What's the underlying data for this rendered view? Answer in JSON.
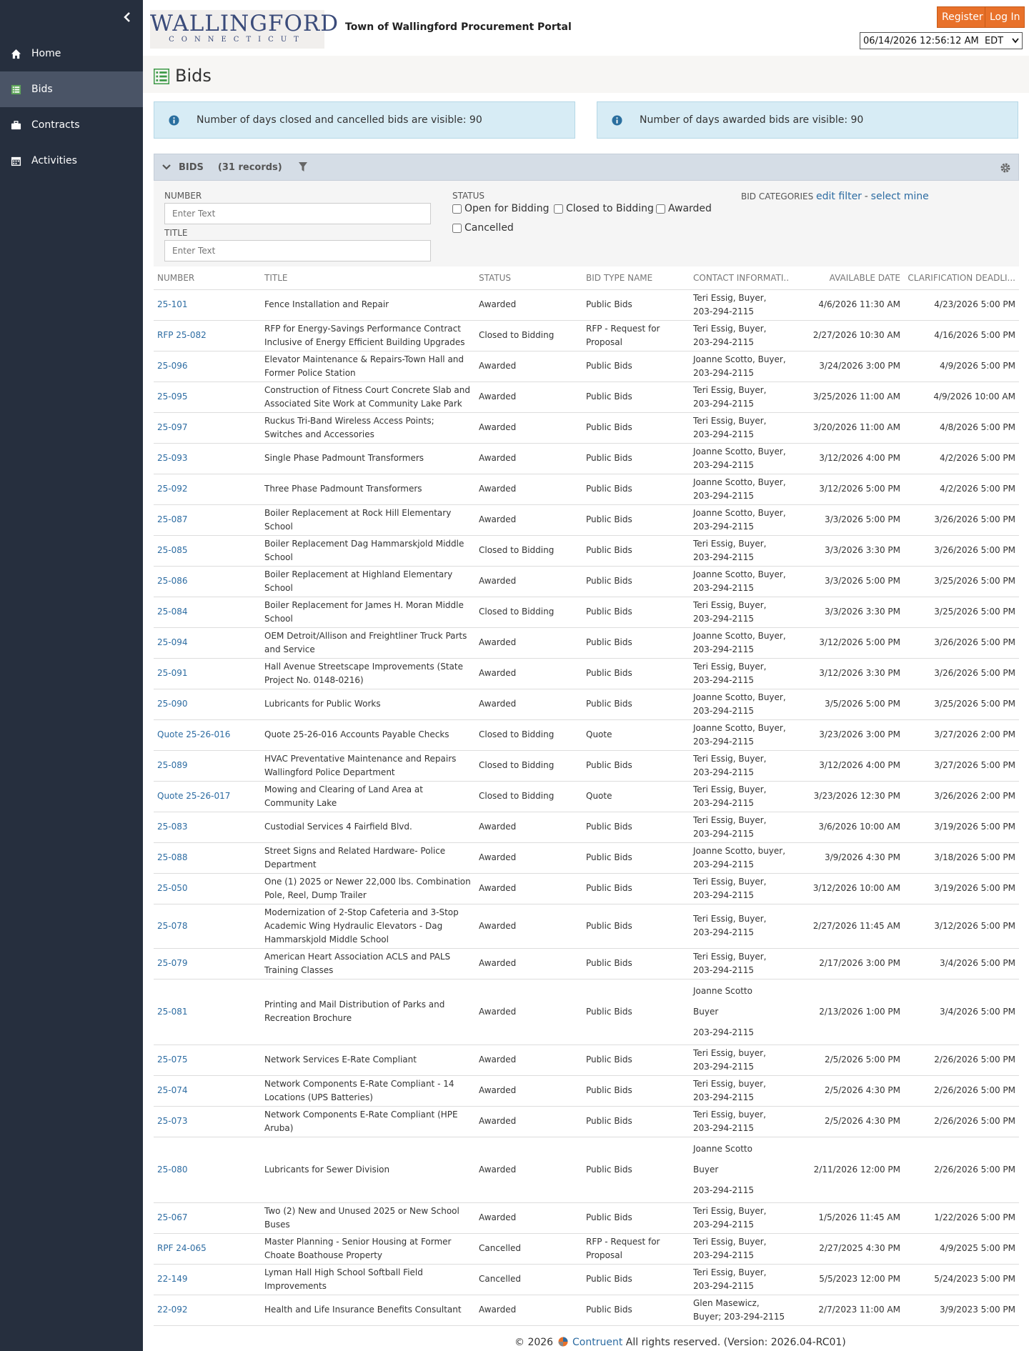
{
  "header": {
    "logo_line1": "WALLINGFORD",
    "logo_line2": "CONNECTICUT",
    "portal_title": "Town of Wallingford Procurement Portal",
    "register_label": "Register",
    "login_label": "Log In",
    "datetime": "06/14/2026 12:56:12 AM",
    "timezone": "EDT"
  },
  "sidebar": {
    "items": [
      {
        "label": "Home",
        "icon": "home-icon"
      },
      {
        "label": "Bids",
        "icon": "list-icon"
      },
      {
        "label": "Contracts",
        "icon": "briefcase-icon"
      },
      {
        "label": "Activities",
        "icon": "calendar-icon"
      }
    ]
  },
  "page": {
    "title": "Bids",
    "info_closed": "Number of days closed and cancelled bids are visible: 90",
    "info_awarded": "Number of days awarded bids are visible: 90"
  },
  "panel": {
    "title": "BIDS",
    "count": "(31 records)"
  },
  "filters": {
    "number_label": "NUMBER",
    "number_placeholder": "Enter Text",
    "title_label": "TITLE",
    "title_placeholder": "Enter Text",
    "status_label": "STATUS",
    "status_options": [
      "Open for Bidding",
      "Closed to Bidding",
      "Awarded",
      "Cancelled"
    ],
    "categories_label": "BID CATEGORIES",
    "edit_filter": "edit filter",
    "separator": "-",
    "select_mine": "select mine"
  },
  "table": {
    "columns": [
      "NUMBER",
      "TITLE",
      "STATUS",
      "BID TYPE NAME",
      "CONTACT INFORMATI...",
      "AVAILABLE DATE",
      "CLARIFICATION DEADLI..."
    ],
    "rows": [
      {
        "number": "25-101",
        "title": "Fence Installation and Repair",
        "status": "Awarded",
        "type": "Public Bids",
        "contact": "Teri Essig, Buyer, 203-294-2115",
        "available": "4/6/2026 11:30 AM",
        "deadline": "4/23/2026 5:00 PM"
      },
      {
        "number": "RFP 25-082",
        "title": "RFP for Energy-Savings Performance Contract Inclusive of Energy Efficient Building Upgrades",
        "status": "Closed to Bidding",
        "type": "RFP - Request for Proposal",
        "contact": "Teri Essig, Buyer, 203-294-2115",
        "available": "2/27/2026 10:30 AM",
        "deadline": "4/16/2026 5:00 PM"
      },
      {
        "number": "25-096",
        "title": "Elevator Maintenance & Repairs-Town Hall and Former Police Station",
        "status": "Awarded",
        "type": "Public Bids",
        "contact": "Joanne Scotto, Buyer, 203-294-2115",
        "available": "3/24/2026 3:00 PM",
        "deadline": "4/9/2026 5:00 PM"
      },
      {
        "number": "25-095",
        "title": "Construction of Fitness Court Concrete Slab and Associated Site Work at Community Lake Park",
        "status": "Awarded",
        "type": "Public Bids",
        "contact": "Teri Essig, Buyer, 203-294-2115",
        "available": "3/25/2026 11:00 AM",
        "deadline": "4/9/2026 10:00 AM"
      },
      {
        "number": "25-097",
        "title": "Ruckus Tri-Band Wireless Access Points; Switches and Accessories",
        "status": "Awarded",
        "type": "Public Bids",
        "contact": "Teri Essig, Buyer, 203-294-2115",
        "available": "3/20/2026 11:00 AM",
        "deadline": "4/8/2026 5:00 PM"
      },
      {
        "number": "25-093",
        "title": "Single Phase Padmount Transformers",
        "status": "Awarded",
        "type": "Public Bids",
        "contact": "Joanne Scotto, Buyer, 203-294-2115",
        "available": "3/12/2026 4:00 PM",
        "deadline": "4/2/2026 5:00 PM"
      },
      {
        "number": "25-092",
        "title": "Three Phase Padmount Transformers",
        "status": "Awarded",
        "type": "Public Bids",
        "contact": "Joanne Scotto, Buyer, 203-294-2115",
        "available": "3/12/2026 5:00 PM",
        "deadline": "4/2/2026 5:00 PM"
      },
      {
        "number": "25-087",
        "title": "Boiler Replacement at Rock Hill Elementary School",
        "status": "Awarded",
        "type": "Public Bids",
        "contact": "Joanne Scotto, Buyer, 203-294-2115",
        "available": "3/3/2026 5:00 PM",
        "deadline": "3/26/2026 5:00 PM"
      },
      {
        "number": "25-085",
        "title": "Boiler Replacement Dag Hammarskjold Middle School",
        "status": "Closed to Bidding",
        "type": "Public Bids",
        "contact": "Teri Essig, Buyer, 203-294-2115",
        "available": "3/3/2026 3:30 PM",
        "deadline": "3/26/2026 5:00 PM"
      },
      {
        "number": "25-086",
        "title": "Boiler Replacement at Highland Elementary School",
        "status": "Awarded",
        "type": "Public Bids",
        "contact": "Joanne Scotto, Buyer, 203-294-2115",
        "available": "3/3/2026 5:00 PM",
        "deadline": "3/25/2026 5:00 PM"
      },
      {
        "number": "25-084",
        "title": "Boiler Replacement for James H. Moran Middle School",
        "status": "Closed to Bidding",
        "type": "Public Bids",
        "contact": "Teri Essig, Buyer, 203-294-2115",
        "available": "3/3/2026 3:30 PM",
        "deadline": "3/25/2026 5:00 PM"
      },
      {
        "number": "25-094",
        "title": "OEM Detroit/Allison and Freightliner Truck Parts and Service",
        "status": "Awarded",
        "type": "Public Bids",
        "contact": "Joanne Scotto, Buyer, 203-294-2115",
        "available": "3/12/2026 5:00 PM",
        "deadline": "3/26/2026 5:00 PM"
      },
      {
        "number": "25-091",
        "title": "Hall Avenue Streetscape Improvements (State Project No. 0148-0216)",
        "status": "Awarded",
        "type": "Public Bids",
        "contact": "Teri Essig, Buyer, 203-294-2115",
        "available": "3/12/2026 3:30 PM",
        "deadline": "3/26/2026 5:00 PM"
      },
      {
        "number": "25-090",
        "title": "Lubricants for Public Works",
        "status": "Awarded",
        "type": "Public Bids",
        "contact": "Joanne Scotto, Buyer, 203-294-2115",
        "available": "3/5/2026 5:00 PM",
        "deadline": "3/25/2026 5:00 PM"
      },
      {
        "number": "Quote 25-26-016",
        "title": "Quote 25-26-016 Accounts Payable Checks",
        "status": "Closed to Bidding",
        "type": "Quote",
        "contact": "Joanne Scotto, Buyer, 203-294-2115",
        "available": "3/23/2026 3:00 PM",
        "deadline": "3/27/2026 2:00 PM"
      },
      {
        "number": "25-089",
        "title": "HVAC Preventative Maintenance and Repairs Wallingford Police Department",
        "status": "Closed to Bidding",
        "type": "Public Bids",
        "contact": "Teri Essig, Buyer, 203-294-2115",
        "available": "3/12/2026 4:00 PM",
        "deadline": "3/27/2026 5:00 PM"
      },
      {
        "number": "Quote 25-26-017",
        "title": "Mowing and Clearing of Land Area at Community Lake",
        "status": "Closed to Bidding",
        "type": "Quote",
        "contact": "Teri Essig, Buyer, 203-294-2115",
        "available": "3/23/2026 12:30 PM",
        "deadline": "3/26/2026 2:00 PM"
      },
      {
        "number": "25-083",
        "title": "Custodial Services 4 Fairfield Blvd.",
        "status": "Awarded",
        "type": "Public Bids",
        "contact": "Teri Essig, Buyer, 203-294-2115",
        "available": "3/6/2026 10:00 AM",
        "deadline": "3/19/2026 5:00 PM"
      },
      {
        "number": "25-088",
        "title": "Street Signs and Related Hardware- Police Department",
        "status": "Awarded",
        "type": "Public Bids",
        "contact": "Joanne Scotto, buyer, 203-294-2115",
        "available": "3/9/2026 4:30 PM",
        "deadline": "3/18/2026 5:00 PM"
      },
      {
        "number": "25-050",
        "title": "One (1) 2025 or Newer 22,000 lbs. Combination Pole, Reel, Dump Trailer",
        "status": "Awarded",
        "type": "Public Bids",
        "contact": "Teri Essig, Buyer, 203-294-2115",
        "available": "3/12/2026 10:00 AM",
        "deadline": "3/19/2026 5:00 PM"
      },
      {
        "number": "25-078",
        "title": "Modernization of 2-Stop Cafeteria and 3-Stop Academic Wing Hydraulic Elevators - Dag Hammarskjold Middle School",
        "status": "Awarded",
        "type": "Public Bids",
        "contact": "Teri Essig, Buyer, 203-294-2115",
        "available": "2/27/2026 11:45 AM",
        "deadline": "3/12/2026 5:00 PM"
      },
      {
        "number": "25-079",
        "title": "American Heart Association ACLS and PALS Training Classes",
        "status": "Awarded",
        "type": "Public Bids",
        "contact": "Teri Essig, Buyer, 203-294-2115",
        "available": "2/17/2026 3:00 PM",
        "deadline": "3/4/2026 5:00 PM"
      },
      {
        "number": "25-081",
        "title": "Printing and Mail Distribution of Parks and Recreation Brochure",
        "status": "Awarded",
        "type": "Public Bids",
        "contact_lines": [
          "Joanne Scotto",
          "Buyer",
          "203-294-2115"
        ],
        "available": "2/13/2026 1:00 PM",
        "deadline": "3/4/2026 5:00 PM"
      },
      {
        "number": "25-075",
        "title": "Network Services E-Rate Compliant",
        "status": "Awarded",
        "type": "Public Bids",
        "contact": "Teri Essig, buyer, 203-294-2115",
        "available": "2/5/2026 5:00 PM",
        "deadline": "2/26/2026 5:00 PM"
      },
      {
        "number": "25-074",
        "title": "Network Components E-Rate Compliant - 14 Locations (UPS Batteries)",
        "status": "Awarded",
        "type": "Public Bids",
        "contact": "Teri Essig, buyer, 203-294-2115",
        "available": "2/5/2026 4:30 PM",
        "deadline": "2/26/2026 5:00 PM"
      },
      {
        "number": "25-073",
        "title": "Network Components E-Rate Compliant (HPE Aruba)",
        "status": "Awarded",
        "type": "Public Bids",
        "contact": "Teri Essig, buyer, 203-294-2115",
        "available": "2/5/2026 4:30 PM",
        "deadline": "2/26/2026 5:00 PM"
      },
      {
        "number": "25-080",
        "title": "Lubricants for Sewer Division",
        "status": "Awarded",
        "type": "Public Bids",
        "contact_lines": [
          "Joanne Scotto",
          "Buyer",
          "203-294-2115"
        ],
        "available": "2/11/2026 12:00 PM",
        "deadline": "2/26/2026 5:00 PM"
      },
      {
        "number": "25-067",
        "title": "Two (2) New and Unused 2025 or New School Buses",
        "status": "Awarded",
        "type": "Public Bids",
        "contact": "Teri Essig, Buyer, 203-294-2115",
        "available": "1/5/2026 11:45 AM",
        "deadline": "1/22/2026 5:00 PM"
      },
      {
        "number": "RPF 24-065",
        "title": "Master Planning - Senior Housing at Former Choate Boathouse Property",
        "status": "Cancelled",
        "type": "RFP - Request for Proposal",
        "contact": "Teri Essig, Buyer, 203-294-2115",
        "available": "2/27/2025 4:30 PM",
        "deadline": "4/9/2025 5:00 PM"
      },
      {
        "number": "22-149",
        "title": "Lyman Hall High School Softball Field Improvements",
        "status": "Cancelled",
        "type": "Public Bids",
        "contact": "Teri Essig, Buyer, 203-294-2115",
        "available": "5/5/2023 12:00 PM",
        "deadline": "5/24/2023 5:00 PM"
      },
      {
        "number": "22-092",
        "title": "Health and Life Insurance Benefits Consultant",
        "status": "Awarded",
        "type": "Public Bids",
        "contact": "Glen Masewicz, Buyer; 203-294-2115",
        "available": "2/7/2023 11:00 AM",
        "deadline": "3/9/2023 5:00 PM"
      }
    ]
  },
  "footer": {
    "copyright": "© 2026",
    "brand": "Contruent",
    "rights": "All rights reserved. (Version: 2026.04-RC01)"
  },
  "colors": {
    "sidebar_bg": "#262f3e",
    "sidebar_active": "#4a5466",
    "accent_orange": "#e8712a",
    "link_blue": "#2d6ca2",
    "info_bg": "#d7ecf5"
  }
}
